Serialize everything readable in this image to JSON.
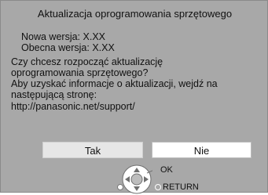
{
  "dialog": {
    "title": "Aktualizacja oprogramowania sprzętowego",
    "new_version_label": "Nowa wersja:",
    "new_version_value": "X.XX",
    "current_version_label": "Obecna wersja:",
    "current_version_value": "X.XX",
    "message_lines": [
      "Czy chcesz rozpocząć aktualizację",
      "oprogramowania sprzętowego?",
      "Aby uzyskać informacje o aktualizacji, wejdź na",
      "następującą stronę:",
      "http://panasonic.net/support/"
    ]
  },
  "buttons": {
    "yes_label": "Tak",
    "no_label": "Nie",
    "selected": "no"
  },
  "hints": {
    "ok_label": "OK",
    "return_label": "RETURN"
  },
  "icons": {
    "navigation": "dpad-icon",
    "return_left": "dot-icon",
    "return_right": "circle-icon"
  },
  "colors": {
    "screen_bg": "#a8a8a8",
    "button_selected_bg": "#ffffff",
    "button_bg": "#e6e6e6",
    "dpad_bg": "#ffffff"
  }
}
